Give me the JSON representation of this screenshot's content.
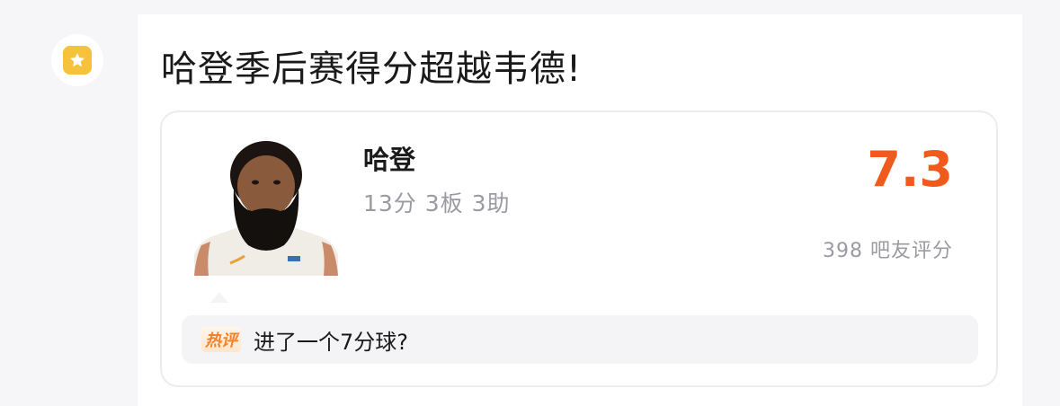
{
  "icons": {
    "badge": "star-icon"
  },
  "post": {
    "title": "哈登季后赛得分超越韦德!"
  },
  "player_card": {
    "name": "哈登",
    "stats": "13分 3板 3助",
    "rating": "7.3",
    "rating_count": "398 吧友评分",
    "avatar": "player-photo"
  },
  "hot_comment": {
    "tag": "热评",
    "text": "进了一个7分球?"
  },
  "colors": {
    "accent": "#f05a1c",
    "badge_yellow": "#f7c23b",
    "muted_text": "#9a9aa2"
  }
}
